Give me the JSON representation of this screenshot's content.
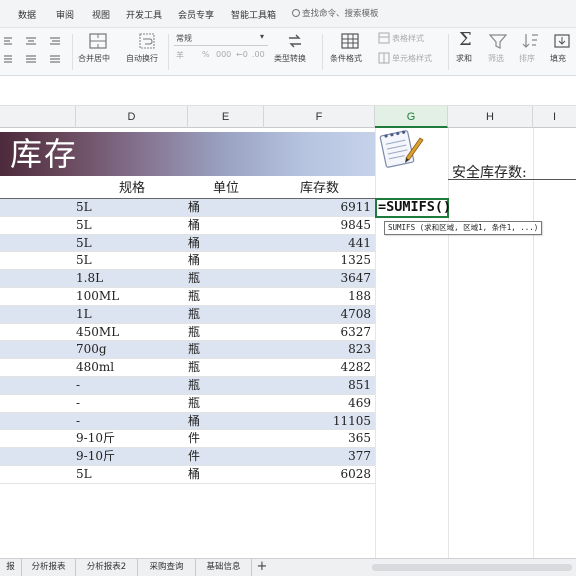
{
  "menu": {
    "items": [
      "数据",
      "审阅",
      "视图",
      "开发工具",
      "会员专享",
      "智能工具箱"
    ],
    "search_placeholder": "查找命令、搜索模板"
  },
  "ribbon": {
    "number_format": "常规",
    "merge_label": "合并居中",
    "wrap_label": "自动换行",
    "format_symbols": [
      "羊",
      "%",
      "000",
      "←0",
      ".00"
    ],
    "type_convert_label": "类型转换",
    "cond_format_label": "条件格式",
    "table_style_label": "表格样式",
    "cell_style_label": "单元格样式",
    "sum_label": "求和",
    "filter_label": "筛选",
    "sort_label": "排序",
    "fill_label": "填充"
  },
  "columns": [
    "D",
    "E",
    "F",
    "G",
    "H",
    "I"
  ],
  "active_column": "G",
  "sheet": {
    "title": "库存",
    "headers": {
      "spec": "规格",
      "unit": "单位",
      "qty": "库存数"
    },
    "rows": [
      {
        "spec": "5L",
        "unit": "桶",
        "qty": "6911"
      },
      {
        "spec": "5L",
        "unit": "桶",
        "qty": "9845"
      },
      {
        "spec": "5L",
        "unit": "桶",
        "qty": "441"
      },
      {
        "spec": "5L",
        "unit": "桶",
        "qty": "1325"
      },
      {
        "spec": "1.8L",
        "unit": "瓶",
        "qty": "3647"
      },
      {
        "spec": "100ML",
        "unit": "瓶",
        "qty": "188"
      },
      {
        "spec": "1L",
        "unit": "瓶",
        "qty": "4708"
      },
      {
        "spec": "450ML",
        "unit": "瓶",
        "qty": "6327"
      },
      {
        "spec": "700g",
        "unit": "瓶",
        "qty": "823"
      },
      {
        "spec": "480ml",
        "unit": "瓶",
        "qty": "4282"
      },
      {
        "spec": "-",
        "unit": "瓶",
        "qty": "851"
      },
      {
        "spec": "-",
        "unit": "瓶",
        "qty": "469"
      },
      {
        "spec": "-",
        "unit": "桶",
        "qty": "11105"
      },
      {
        "spec": "9-10斤",
        "unit": "件",
        "qty": "365"
      },
      {
        "spec": "9-10斤",
        "unit": "件",
        "qty": "377"
      },
      {
        "spec": "5L",
        "unit": "桶",
        "qty": "6028"
      }
    ],
    "safety_stock_label": "安全库存数:",
    "formula": "=SUMIFS()",
    "formula_tooltip": "SUMIFS (求和区域, 区域1, 条件1, ...)"
  },
  "tabs": [
    "报",
    "分析报表",
    "分析报表2",
    "采购查询",
    "基础信息"
  ],
  "colors": {
    "accent_green": "#1e7b3c",
    "row_alt": "#dce4f1",
    "banner_start": "#4c2a3c",
    "banner_end": "#c6d2ea"
  }
}
